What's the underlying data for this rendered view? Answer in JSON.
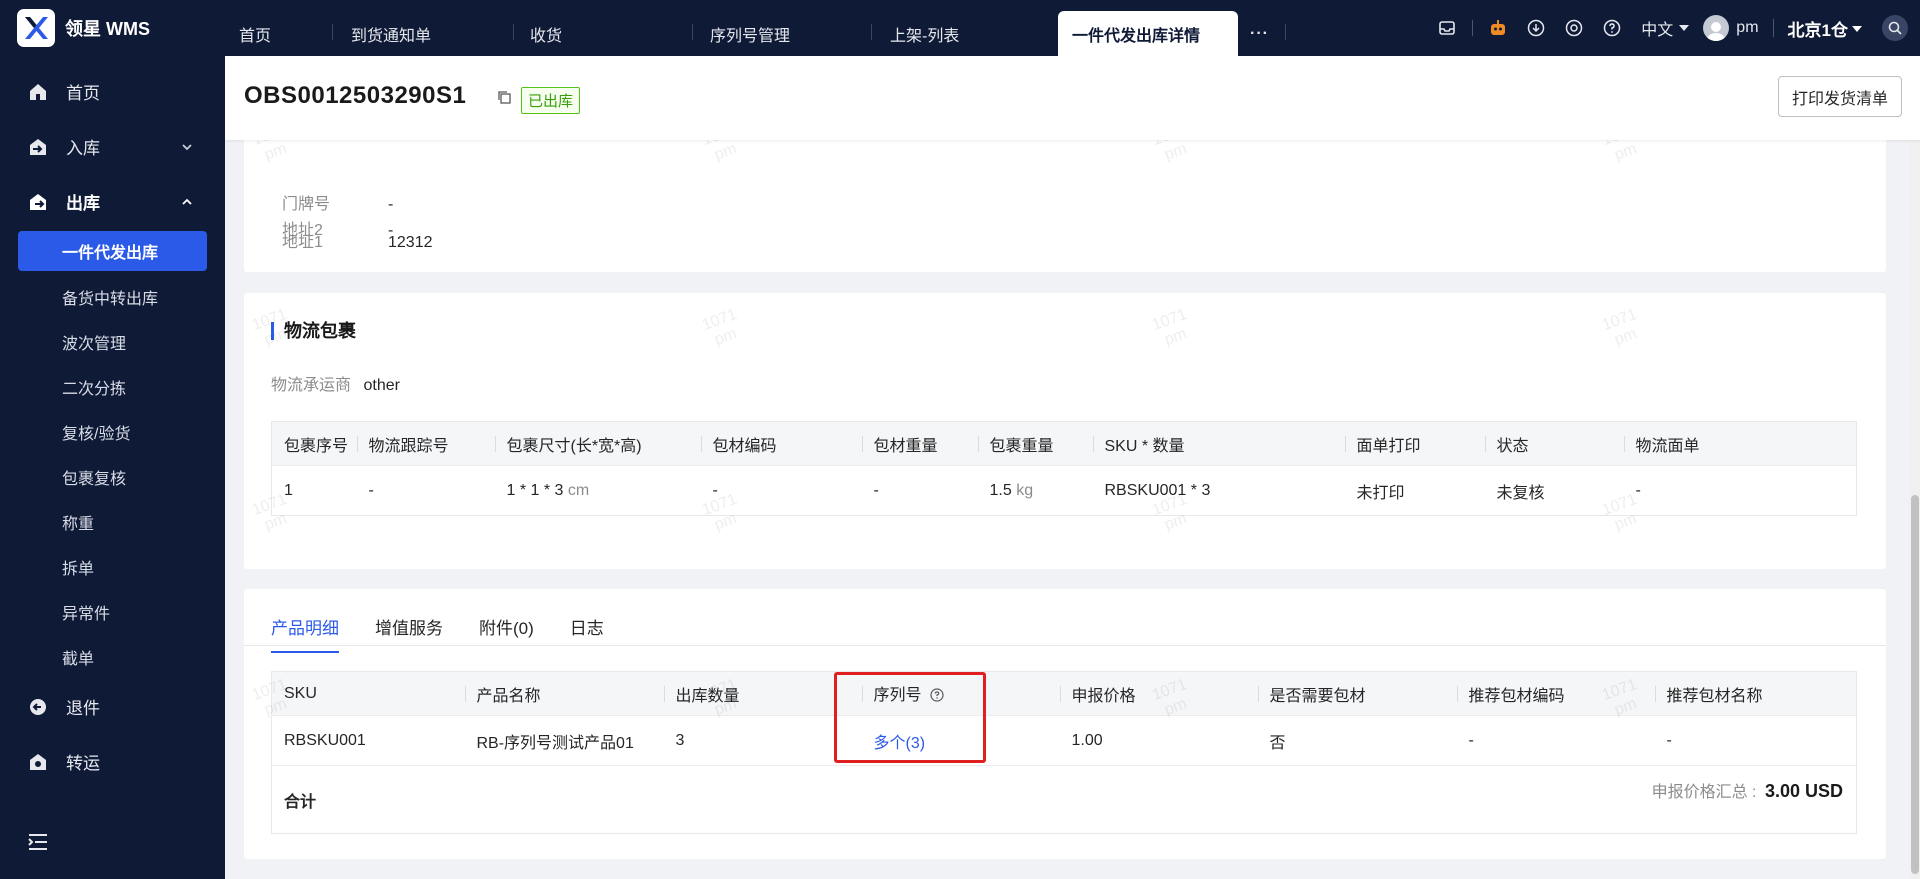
{
  "app": {
    "name": "领星 WMS"
  },
  "sidebar": {
    "home": "首页",
    "inbound": "入库",
    "outbound": "出库",
    "outbound_items": [
      "一件代发出库",
      "备货中转出库",
      "波次管理",
      "二次分拣",
      "复核/验货",
      "包裹复核",
      "称重",
      "拆单",
      "异常件",
      "截单"
    ],
    "returns": "退件",
    "transfer": "转运"
  },
  "topbar": {
    "tabs": [
      "首页",
      "到货通知单",
      "收货",
      "序列号管理",
      "上架-列表"
    ],
    "active_tab": "一件代发出库详情",
    "more": "···",
    "language": "中文",
    "user": "pm",
    "warehouse": "北京1仓"
  },
  "header": {
    "order_no": "OBS0012503290S1",
    "status": "已出库",
    "print_button": "打印发货清单"
  },
  "address": {
    "rows": [
      {
        "label": "门牌号",
        "value": "-"
      },
      {
        "label": "地址1",
        "value": "12312"
      },
      {
        "label": "地址2",
        "value": "-"
      }
    ]
  },
  "logistics": {
    "title": "物流包裹",
    "carrier_label": "物流承运商",
    "carrier_value": "other",
    "columns": [
      "包裹序号",
      "物流跟踪号",
      "包裹尺寸(长*宽*高)",
      "包材编码",
      "包材重量",
      "包裹重量",
      "SKU * 数量",
      "面单打印",
      "状态",
      "物流面单"
    ],
    "row": {
      "index": "1",
      "tracking": "-",
      "size": "1 * 1 * 3",
      "size_unit": "cm",
      "material_code": "-",
      "material_weight": "-",
      "weight": "1.5",
      "weight_unit": "kg",
      "sku_qty": "RBSKU001 * 3",
      "label_print": "未打印",
      "status": "未复核",
      "waybill": "-"
    }
  },
  "detail_tabs": [
    "产品明细",
    "增值服务",
    "附件(0)",
    "日志"
  ],
  "products": {
    "columns": [
      "SKU",
      "产品名称",
      "出库数量",
      "序列号",
      "申报价格",
      "是否需要包材",
      "推荐包材编码",
      "推荐包材名称"
    ],
    "row": {
      "sku": "RBSKU001",
      "name": "RB-序列号测试产品01",
      "qty": "3",
      "serial": "多个(3)",
      "price": "1.00",
      "need_material": "否",
      "rec_code": "-",
      "rec_name": "-"
    },
    "total_label": "合计",
    "summary_label": "申报价格汇总 :",
    "summary_value": "3.00 USD"
  },
  "watermark": {
    "line1": "1071",
    "line2": "pm"
  },
  "colors": {
    "nav_bg": "#0f1a36",
    "accent": "#2c5ae8",
    "success": "#52c41a",
    "highlight": "#e0201f"
  }
}
